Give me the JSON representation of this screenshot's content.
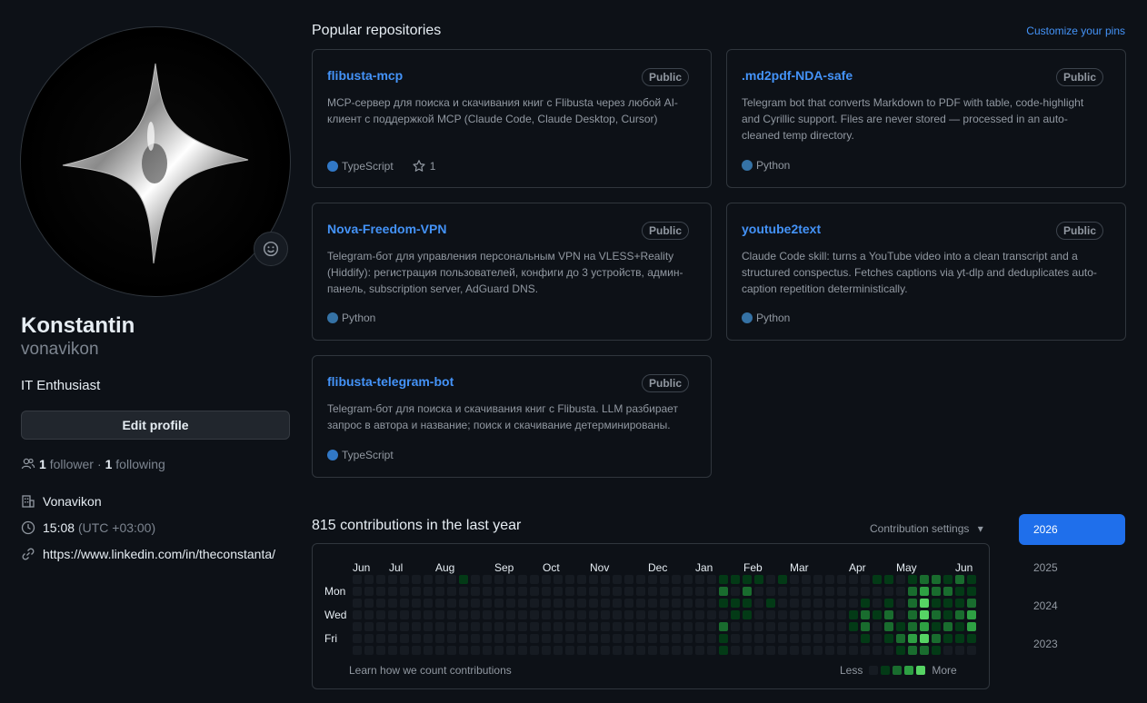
{
  "profile": {
    "name": "Konstantin",
    "login": "vonavikon",
    "bio": "IT Enthusiast",
    "edit_label": "Edit profile",
    "followers_count": "1",
    "followers_label": "follower",
    "sep": "·",
    "following_count": "1",
    "following_label": "following",
    "company": "Vonavikon",
    "time": "15:08",
    "timezone": "(UTC +03:00)",
    "link": "https://www.linkedin.com/in/theconstanta/"
  },
  "pinned": {
    "title": "Popular repositories",
    "customize_label": "Customize your pins",
    "repos": [
      {
        "name": "flibusta-mcp",
        "visibility": "Public",
        "description": "MCP-сервер для поиска и скачивания книг с Flibusta через любой AI-клиент с поддержкой MCP (Claude Code, Claude Desktop, Cursor)",
        "language": "TypeScript",
        "lang_color": "#3178c6",
        "stars": "1"
      },
      {
        "name": ".md2pdf-NDA-safe",
        "visibility": "Public",
        "description": "Telegram bot that converts Markdown to PDF with table, code-highlight and Cyrillic support. Files are never stored — processed in an auto-cleaned temp directory.",
        "language": "Python",
        "lang_color": "#3572A5"
      },
      {
        "name": "Nova-Freedom-VPN",
        "visibility": "Public",
        "description": "Telegram-бот для управления персональным VPN на VLESS+Reality (Hiddify): регистрация пользователей, конфиги до 3 устройств, админ-панель, subscription server, AdGuard DNS.",
        "language": "Python",
        "lang_color": "#3572A5"
      },
      {
        "name": "youtube2text",
        "visibility": "Public",
        "description": "Claude Code skill: turns a YouTube video into a clean transcript and a structured conspectus. Fetches captions via yt-dlp and deduplicates auto-caption repetition deterministically.",
        "language": "Python",
        "lang_color": "#3572A5"
      },
      {
        "name": "flibusta-telegram-bot",
        "visibility": "Public",
        "description": "Telegram-бот для поиска и скачивания книг с Flibusta. LLM разбирает запрос в автора и название; поиск и скачивание детерминированы.",
        "language": "TypeScript",
        "lang_color": "#3178c6"
      }
    ]
  },
  "contributions": {
    "title": "815 contributions in the last year",
    "settings_label": "Contribution settings",
    "months": [
      "Jun",
      "Jul",
      "Aug",
      "Sep",
      "Oct",
      "Nov",
      "Dec",
      "Jan",
      "Feb",
      "Mar",
      "Apr",
      "May",
      "Jun"
    ],
    "days": [
      "Mon",
      "Wed",
      "Fri"
    ],
    "learn_label": "Learn how we count contributions",
    "less_label": "Less",
    "more_label": "More",
    "colors": [
      "#161b22",
      "#033a16",
      "#196c2e",
      "#2ea043",
      "#56d364"
    ],
    "years": [
      "2026",
      "2025",
      "2024",
      "2023"
    ],
    "selected_year": "2026"
  }
}
